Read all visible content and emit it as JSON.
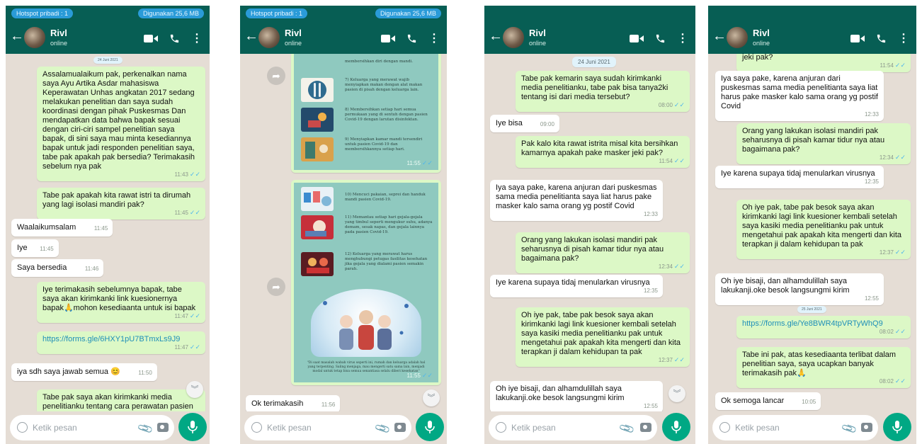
{
  "common": {
    "contact_name": "Rivl",
    "contact_status": "online",
    "input_placeholder": "Ketik pesan",
    "hotspot_label": "Hotspot pribadi : 1",
    "data_usage_label": "Digunakan 25,6 MB",
    "double_tick": "✓✓",
    "colors": {
      "header": "#075e54",
      "outgoing_bubble": "#dcf8c6",
      "incoming_bubble": "#ffffff",
      "chat_background": "#e5ddd5",
      "mic_button": "#00a884",
      "read_ticks": "#4fb6ec"
    },
    "icons": [
      "back-arrow-icon",
      "avatar",
      "video-call-icon",
      "phone-icon",
      "more-options-icon",
      "emoji-icon",
      "attach-icon",
      "camera-icon",
      "mic-icon",
      "forward-icon",
      "scroll-down-icon"
    ]
  },
  "screen1": {
    "date_chip": "24 Juni 2021",
    "messages": [
      {
        "dir": "out",
        "text": "Assalamualaikum pak, perkenalkan nama saya Ayu Artika Asdar mahasiswa Keperawatan Unhas angkatan 2017 sedang melakukan penelitian dan saya sudah koordinasi dengan pihak Puskesmas Dan mendapatkan data bahwa bapak sesuai dengan ciri-ciri sampel penelitian saya bapak, di sini saya mau minta kesediannya bapak untuk jadi responden penelitian saya, tabe pak apakah pak bersedia? Terimakasih sebelum nya pak",
        "time": "11:43"
      },
      {
        "dir": "out",
        "text": "Tabe pak apakah kita rawat istri ta dirumah yang lagi isolasi mandiri pak?",
        "time": "11:45"
      },
      {
        "dir": "in",
        "text": "Waalaikumsalam",
        "time": "11:45"
      },
      {
        "dir": "in",
        "text": "Iye",
        "time": "11:45"
      },
      {
        "dir": "in",
        "text": "Saya bersedia",
        "time": "11:46"
      },
      {
        "dir": "out",
        "text": "Iye terimakasih sebelumnya bapak, tabe saya akan kirimkanki link kuesionernya bapak🙏mohon kesediaanta untuk isi bapak",
        "time": "11:47"
      },
      {
        "dir": "out",
        "text": "https://forms.gle/6HXY1pU7BTmxLs9J9",
        "time": "11:47"
      },
      {
        "dir": "in",
        "text": "iya sdh saya jawab semua 😊",
        "time": "11:50"
      },
      {
        "dir": "out",
        "text": "Tabe pak saya akan kirimkanki media penelitianku tentang cara perawatan pasien",
        "time": ""
      }
    ]
  },
  "screen2": {
    "poster1": {
      "items": [
        "membersihkan diri dengan mandi.",
        "7) Keluarga yang merawat wajib menyiapkan makan dengan alat makan pasien di pisah dengan keluarga lain.",
        "8) Membersihkan setiap hari semua permukaan yang di sentuh dengan pasien Covid-19 dengan larutan disinfektan.",
        "9) Menyiapkan kamar mandi tersendiri untuk pasien Covid-19 dan membersihkannya setiap hari."
      ],
      "time": "11:55"
    },
    "poster2": {
      "items": [
        "10) Mencuci pakaian, seprei dan handuk mandi pasien Covid-19.",
        "11) Memantau setiap hari gejala-gejala yang timbul seperti mengukur suhu, adanya demam, sesak napas, dan gejala lainnya pada pasien Covid-19.",
        "12) Keluarga yang merawat harus menghubungi petugas fasilitas kesehatan jika gejala yang dialami pasien semakin parah."
      ],
      "caption": "\"Di saat masalah wabah virus seperti ini, rumah dan keluarga adalah hal yang terpenting. Saling menjaga, mau mengerti satu sama lain, menjadi modal untuk tetap bisa semua senantiasa selalu diberi kesehatan\"",
      "time": "11:55"
    },
    "messages": [
      {
        "dir": "in",
        "text": "Ok terimakasih",
        "time": "11:56"
      }
    ]
  },
  "screen3": {
    "date_chip": "24 Juni 2021",
    "messages": [
      {
        "dir": "out",
        "text": "Tabe pak kemarin saya sudah kirimkanki media penelitianku, tabe pak bisa tanya2ki tentang isi dari media tersebut?",
        "time": "08:00"
      },
      {
        "dir": "in",
        "text": "Iye bisa",
        "time": "09:00"
      },
      {
        "dir": "out",
        "text": "Pak kalo kita rawat istrita misal kita bersihkan kamarnya apakah pake masker jeki pak?",
        "time": "11:54"
      },
      {
        "dir": "in",
        "text": "Iya saya pake, karena anjuran dari puskesmas sama media penelitianta saya liat harus pake masker kalo sama orang yg postif Covid",
        "time": "12:33"
      },
      {
        "dir": "out",
        "text": "Orang yang lakukan isolasi mandiri pak seharusnya di pisah kamar tidur nya atau bagaimana pak?",
        "time": "12:34"
      },
      {
        "dir": "in",
        "text": "Iye karena supaya tidaj menularkan virusnya",
        "time": "12:35"
      },
      {
        "dir": "out",
        "text": "Oh iye pak, tabe pak besok saya akan kirimkanki lagi link kuesioner kembali setelah saya kasiki media penelitianku pak untuk mengetahui pak apakah kita mengerti dan kita terapkan ji dalam kehidupan ta pak",
        "time": "12:37"
      },
      {
        "dir": "in",
        "text": "Oh iye bisaji, dan alhamdulillah saya lakukanji.oke besok langsungmi kirim",
        "time": "12:55"
      }
    ]
  },
  "screen4": {
    "date_chip": "25 Juni 2021",
    "messages": [
      {
        "dir": "out",
        "text": "jeki pak?",
        "time": "11:54"
      },
      {
        "dir": "in",
        "text": "Iya saya pake, karena anjuran dari puskesmas sama media penelitianta saya liat harus pake masker kalo sama orang yg postif Covid",
        "time": "12:33"
      },
      {
        "dir": "out",
        "text": "Orang yang lakukan isolasi mandiri pak seharusnya di pisah kamar tidur nya atau bagaimana pak?",
        "time": "12:34"
      },
      {
        "dir": "in",
        "text": "Iye karena supaya tidaj menularkan virusnya",
        "time": "12:35"
      },
      {
        "dir": "out",
        "text": "Oh iye pak, tabe pak besok saya akan kirimkanki lagi link kuesioner kembali setelah saya kasiki media penelitianku pak untuk mengetahui pak apakah kita mengerti dan kita terapkan ji dalam kehidupan ta pak",
        "time": "12:37"
      },
      {
        "dir": "in",
        "text": "Oh iye bisaji, dan alhamdulillah saya lakukanji.oke besok langsungmi kirim",
        "time": "12:55"
      },
      {
        "dir": "out",
        "text": "https://forms.gle/Ye8BWR4tpVRTyWhQ9",
        "time": "08:02"
      },
      {
        "dir": "out",
        "text": "Tabe ini pak, atas kesediaanta terlibat dalam penelitian saya, saya ucapkan banyak terimakasih pak🙏",
        "time": "08:02"
      },
      {
        "dir": "in",
        "text": "Ok semoga lancar",
        "time": "10:05"
      }
    ]
  }
}
